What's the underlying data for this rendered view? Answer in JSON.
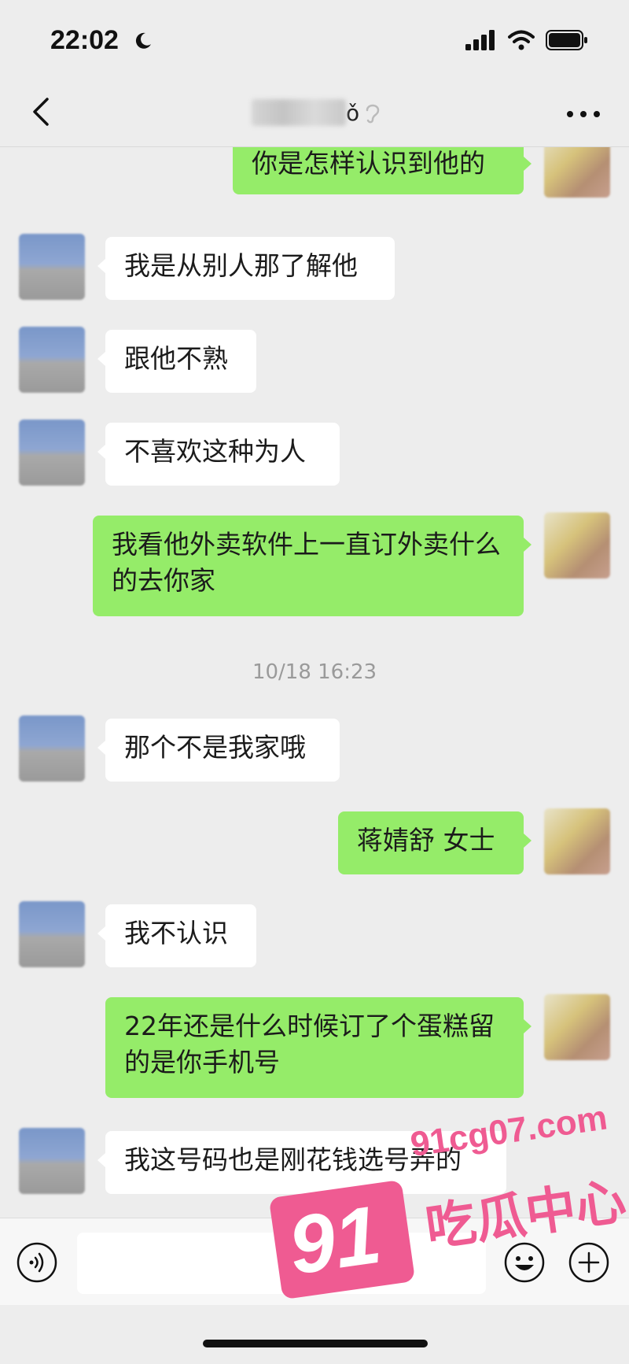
{
  "status_bar": {
    "time": "22:02",
    "icons": [
      "moon-icon",
      "signal-icon",
      "wifi-icon",
      "battery-icon"
    ]
  },
  "nav": {
    "title_suffix": "ǒ"
  },
  "messages": [
    {
      "side": "right",
      "text": "你是怎样认识到他的"
    },
    {
      "side": "left",
      "text": "我是从别人那了解他"
    },
    {
      "side": "left",
      "text": "跟他不熟"
    },
    {
      "side": "left",
      "text": "不喜欢这种为人"
    },
    {
      "side": "right",
      "text": "我看他外卖软件上一直订外卖什么的去你家"
    },
    {
      "side": "left",
      "text": "那个不是我家哦"
    },
    {
      "side": "right",
      "text": "蒋婧舒 女士"
    },
    {
      "side": "left",
      "text": "我不认识"
    },
    {
      "side": "right",
      "text": "22年还是什么时候订了个蛋糕留的是你手机号"
    },
    {
      "side": "left",
      "text": "我这号码也是刚花钱选号弄的"
    }
  ],
  "timestamp": "10/18 16:23",
  "watermark": {
    "site": "91cg07.com",
    "number": "91",
    "name": "吃瓜中心"
  },
  "colors": {
    "background": "#ededed",
    "bubble_sent": "#95ec69",
    "bubble_received": "#ffffff",
    "watermark": "#ef5b92"
  }
}
